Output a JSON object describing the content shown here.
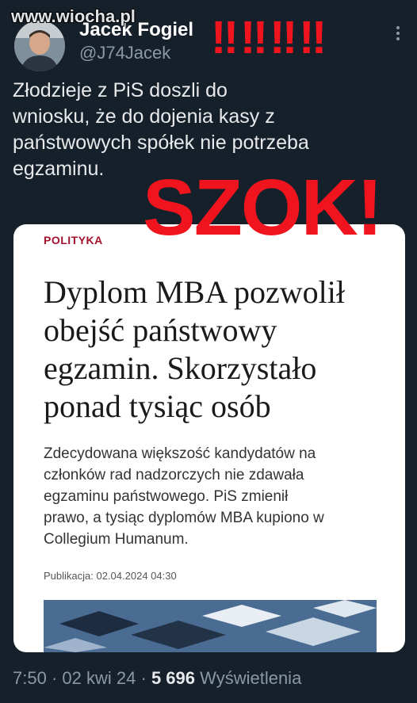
{
  "watermark": "www.wiocha.pl",
  "author": {
    "name": "Jacek Fogiel",
    "handle": "@J74Jacek"
  },
  "overlay": {
    "alarm": "‼‼‼‼",
    "szok": "SZOK!"
  },
  "tweet": {
    "lines": [
      "Złodzieje z PiS doszli do",
      "wniosku, że do dojenia kasy z",
      "państwowych spółek nie potrzeba",
      "egzaminu."
    ]
  },
  "article": {
    "category": "POLITYKA",
    "headline_lines": [
      "Dyplom MBA pozwolił",
      "obejść państwowy",
      "egzamin. Skorzystało",
      "ponad tysiąc osób"
    ],
    "lead_lines": [
      "Zdecydowana większość kandydatów na",
      "członków rad nadzorczych nie zdawała",
      "egzaminu państwowego. PiS zmienił",
      "prawo, a tysiąc dyplomów MBA kupiono w",
      "Collegium Humanum."
    ],
    "published": "Publikacja: 02.04.2024 04:30"
  },
  "meta": {
    "time": "7:50",
    "separator": "·",
    "date": "02 kwi 24",
    "views_count": "5 696",
    "views_label": "Wyświetlenia"
  },
  "colors": {
    "background": "#15202b",
    "alert_red": "#f0141e",
    "category_red": "#a3122d",
    "muted": "#8b98a5"
  },
  "icons": [
    "more-options-icon"
  ]
}
